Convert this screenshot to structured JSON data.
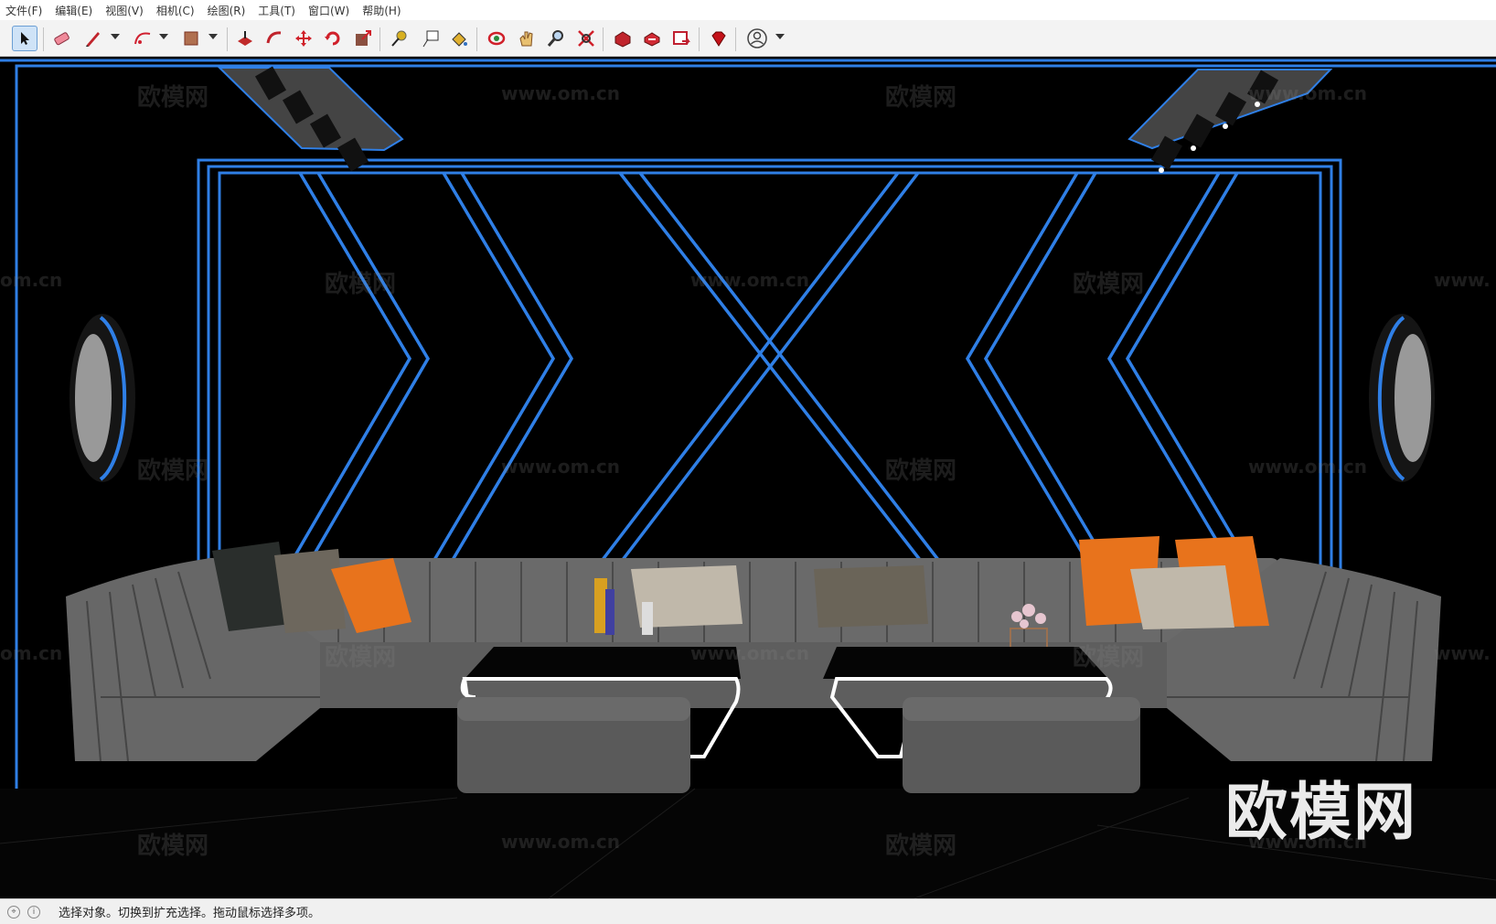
{
  "menu": {
    "items": [
      "文件(F)",
      "编辑(E)",
      "视图(V)",
      "相机(C)",
      "绘图(R)",
      "工具(T)",
      "窗口(W)",
      "帮助(H)"
    ]
  },
  "toolbar": {
    "tools": [
      {
        "icon": "select-arrow-icon",
        "active": true
      },
      {
        "icon": "eraser-icon"
      },
      {
        "icon": "pencil-line-icon",
        "has_dropdown": true
      },
      {
        "icon": "arc-icon",
        "has_dropdown": true
      },
      {
        "icon": "rectangle-icon",
        "has_dropdown": true
      },
      {
        "icon": "push-pull-icon"
      },
      {
        "icon": "follow-me-icon"
      },
      {
        "icon": "move-icon"
      },
      {
        "icon": "rotate-icon"
      },
      {
        "icon": "scale-icon"
      },
      {
        "icon": "tape-measure-icon"
      },
      {
        "icon": "text-icon"
      },
      {
        "icon": "paint-bucket-icon"
      },
      {
        "icon": "orbit-icon"
      },
      {
        "icon": "pan-icon"
      },
      {
        "icon": "zoom-icon"
      },
      {
        "icon": "zoom-extents-icon"
      },
      {
        "icon": "3d-warehouse-icon"
      },
      {
        "icon": "extension-warehouse-icon"
      },
      {
        "icon": "layout-icon"
      },
      {
        "icon": "ruby-console-icon"
      },
      {
        "icon": "user-account-icon",
        "has_dropdown": true
      }
    ]
  },
  "viewport": {
    "watermarks": [
      "欧模网",
      "www.om.cn",
      "om.cn",
      "www."
    ],
    "brand_watermark": "欧模网",
    "colors": {
      "neon_blue": "#2f7fe6",
      "sofa_gray": "#6a6a6a",
      "pillow_orange": "#e8731c",
      "background": "#000000"
    }
  },
  "status": {
    "text": "选择对象。切换到扩充选择。拖动鼠标选择多项。"
  }
}
